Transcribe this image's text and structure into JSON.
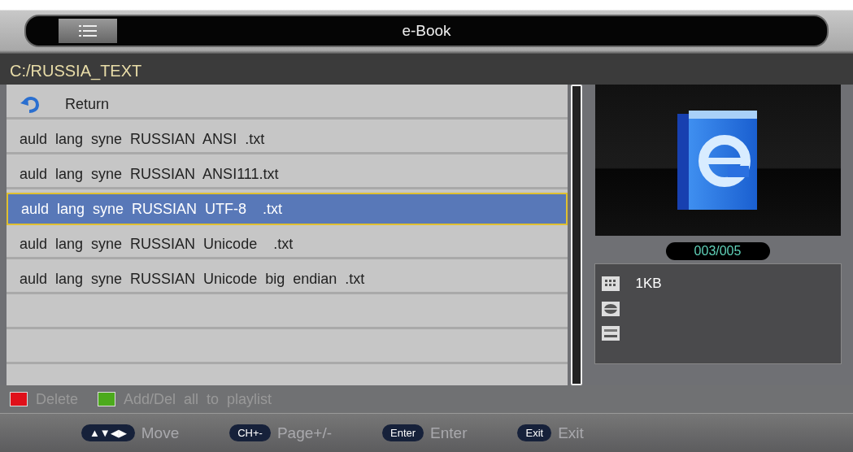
{
  "window": {
    "title": "e-Book"
  },
  "path": "C:/RUSSIA_TEXT",
  "files": [
    {
      "kind": "return",
      "name": "Return",
      "selected": false
    },
    {
      "kind": "file",
      "name": "auld  lang  syne  RUSSIAN  ANSI  .txt",
      "selected": false
    },
    {
      "kind": "file",
      "name": "auld  lang  syne  RUSSIAN  ANSI111.txt",
      "selected": false
    },
    {
      "kind": "file",
      "name": "auld  lang  syne  RUSSIAN  UTF-8    .txt",
      "selected": true
    },
    {
      "kind": "file",
      "name": "auld  lang  syne  RUSSIAN  Unicode    .txt",
      "selected": false
    },
    {
      "kind": "file",
      "name": "auld  lang  syne  RUSSIAN  Unicode  big  endian  .txt",
      "selected": false
    }
  ],
  "counter": "003/005",
  "info": [
    {
      "kind": "size",
      "value": "1KB"
    },
    {
      "kind": "disc"
    },
    {
      "kind": "device"
    }
  ],
  "legend": [
    {
      "label": "Delete",
      "color": "#e0101a"
    },
    {
      "label": "Add/Del  all  to  playlist",
      "color": "#4caa1c"
    }
  ],
  "footer": [
    {
      "key": "▲▼◀▶",
      "action": "Move"
    },
    {
      "key": "CH+-",
      "action": "Page+/-"
    },
    {
      "key": "Enter",
      "action": "Enter"
    },
    {
      "key": "Exit",
      "action": "Exit"
    }
  ]
}
